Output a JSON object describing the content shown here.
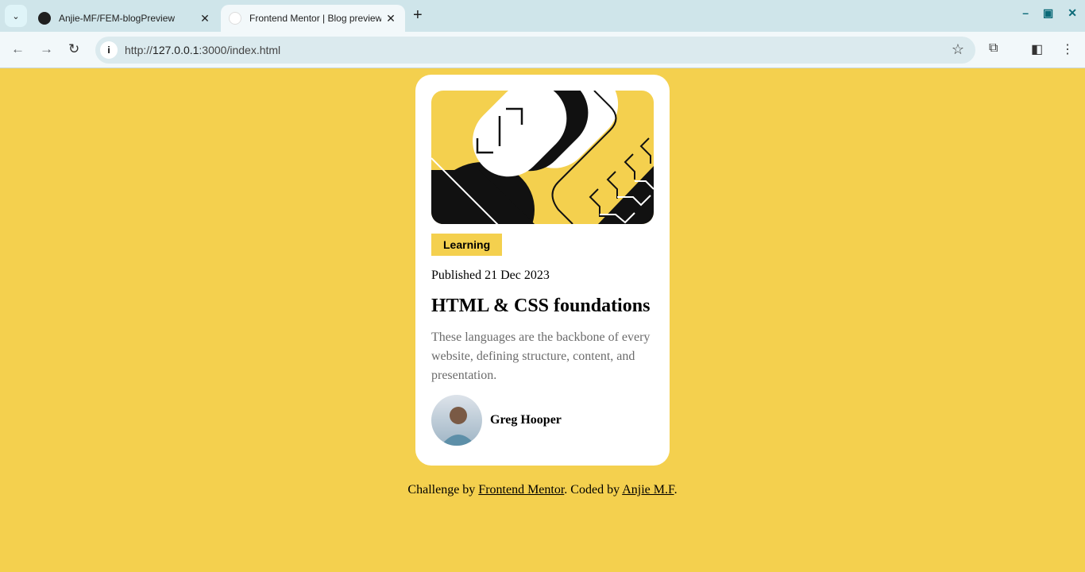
{
  "browser": {
    "tabs": [
      {
        "title": "Anjie-MF/FEM-blogPreview",
        "icon": "github-icon"
      },
      {
        "title": "Frontend Mentor | Blog preview",
        "icon": "frontend-mentor-icon",
        "active": true
      }
    ],
    "url_prefix": "http://",
    "url_host": "127.0.0.1",
    "url_rest": ":3000/index.html"
  },
  "card": {
    "tag": "Learning",
    "published": "Published 21 Dec 2023",
    "title": "HTML & CSS foundations",
    "description": "These languages are the backbone of every website, defining structure, content, and presentation.",
    "author": "Greg Hooper"
  },
  "footer": {
    "text1": "Challenge by ",
    "link1": "Frontend Mentor",
    "text2": ". Coded by ",
    "link2": "Anjie M.F",
    "text3": "."
  },
  "colors": {
    "background": "#f4d04e",
    "card": "#ffffff",
    "text": "#111111",
    "muted": "#6b6b6b"
  }
}
